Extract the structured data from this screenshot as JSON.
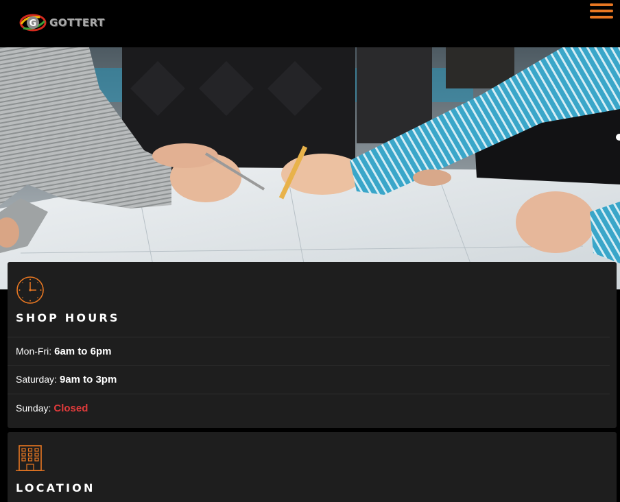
{
  "header": {
    "logo_letter": "G",
    "logo_text": "GOTTERT",
    "menu_icon": "hamburger-icon"
  },
  "colors": {
    "accent": "#e87722",
    "card_bg": "#1e1e1e",
    "closed": "#e03b3b"
  },
  "hero": {
    "image": "team-reviewing-blueprints-photo"
  },
  "hours": {
    "icon": "clock-icon",
    "title": "SHOP HOURS",
    "rows": [
      {
        "day": "Mon-Fri:",
        "time": "6am to 6pm"
      },
      {
        "day": "Saturday:",
        "time": "9am to 3pm"
      },
      {
        "day": "Sunday:",
        "time": "Closed"
      }
    ]
  },
  "location": {
    "icon": "building-icon",
    "title": "LOCATION"
  }
}
